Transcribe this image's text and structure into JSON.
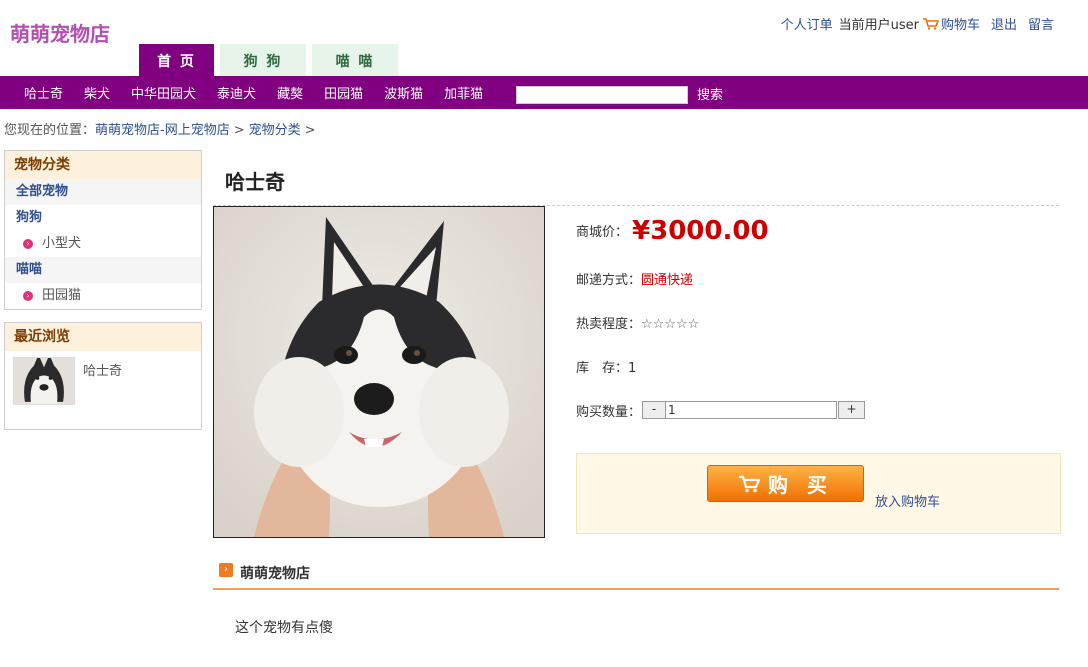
{
  "header": {
    "logo": "萌萌宠物店",
    "links": {
      "orders": "个人订单",
      "current_user": "当前用户user",
      "cart": "购物车",
      "logout": "退出",
      "message": "留言"
    },
    "tabs": [
      "首 页",
      "狗 狗",
      "喵 喵"
    ]
  },
  "navbar": {
    "items": [
      "哈士奇",
      "柴犬",
      "中华田园犬",
      "泰迪犬",
      "藏獒",
      "田园猫",
      "波斯猫",
      "加菲猫"
    ],
    "search_value": "",
    "search_label": "搜索"
  },
  "breadcrumb": {
    "prefix": "您现在的位置：",
    "home": "萌萌宠物店-网上宠物店",
    "sep": ">",
    "category": "宠物分类"
  },
  "sidebar": {
    "categories_title": "宠物分类",
    "all": "全部宠物",
    "groups": [
      {
        "name": "狗狗",
        "children": [
          "小型犬"
        ]
      },
      {
        "name": "喵喵",
        "children": [
          "田园猫"
        ]
      }
    ],
    "recent_title": "最近浏览",
    "recent_items": [
      {
        "name": "哈士奇"
      }
    ]
  },
  "product": {
    "title": "哈士奇",
    "price_label": "商城价：",
    "price": "¥3000.00",
    "shipping_label": "邮递方式：",
    "shipping": "圆通快递",
    "hot_label": "热卖程度：",
    "hot_stars": "☆☆☆☆☆",
    "stock_label": "库　存：",
    "stock": "1",
    "qty_label": "购买数量：",
    "qty_minus": "-",
    "qty_value": "1",
    "qty_plus": "+",
    "buy_label": "购 买",
    "add_cart": "放入购物车"
  },
  "shop": {
    "name": "萌萌宠物店",
    "description": "这个宠物有点傻"
  },
  "colors": {
    "nav_purple": "#800080",
    "price_red": "#cc0000",
    "buy_orange": "#f07000"
  }
}
